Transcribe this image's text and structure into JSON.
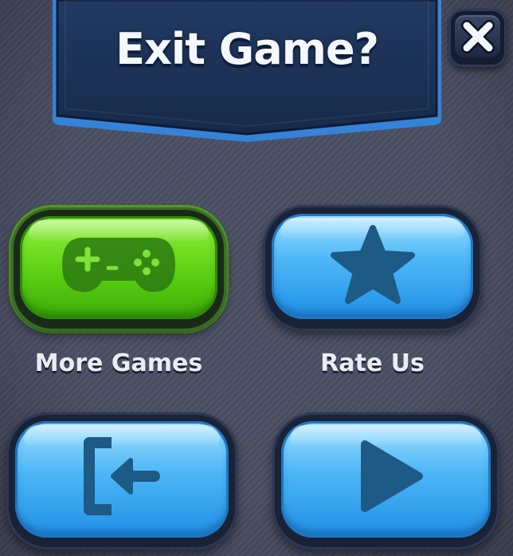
{
  "dialog": {
    "title": "Exit Game?"
  },
  "buttons": {
    "close": {
      "icon": "close-icon"
    },
    "more_games": {
      "label": "More Games",
      "icon": "gamepad-icon",
      "color": "#5dd113"
    },
    "rate_us": {
      "label": "Rate Us",
      "icon": "star-icon",
      "color": "#4cb6f6"
    },
    "exit": {
      "icon": "exit-door-icon",
      "color": "#4cb6f6"
    },
    "resume": {
      "icon": "play-icon",
      "color": "#4cb6f6"
    }
  },
  "theme": {
    "background": "#4b4f63",
    "banner": "#1b2e52",
    "icon_dark": "#1e5a86",
    "icon_green_dark": "#2b7a12"
  }
}
